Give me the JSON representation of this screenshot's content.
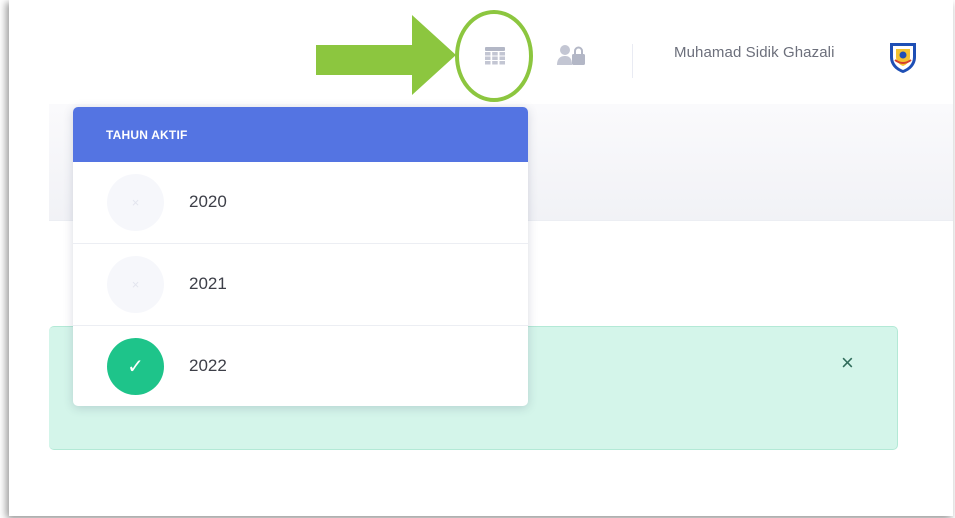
{
  "header": {
    "icons": [
      "calendar-icon",
      "user-lock-icon"
    ],
    "user_name": "Muhamad Sidik Ghazali"
  },
  "year_dropdown": {
    "title": "TAHUN AKTIF",
    "items": [
      {
        "year": "2020",
        "active": false,
        "badge_glyph": "×"
      },
      {
        "year": "2021",
        "active": false,
        "badge_glyph": "×"
      },
      {
        "year": "2022",
        "active": true,
        "badge_glyph": "✓"
      }
    ]
  },
  "alert": {
    "close_glyph": "×"
  },
  "colors": {
    "dropdown_header": "#5474e2",
    "active_badge": "#1ec48a",
    "alert_background": "#d4f5ea",
    "annotation_green": "#8cc63f"
  }
}
